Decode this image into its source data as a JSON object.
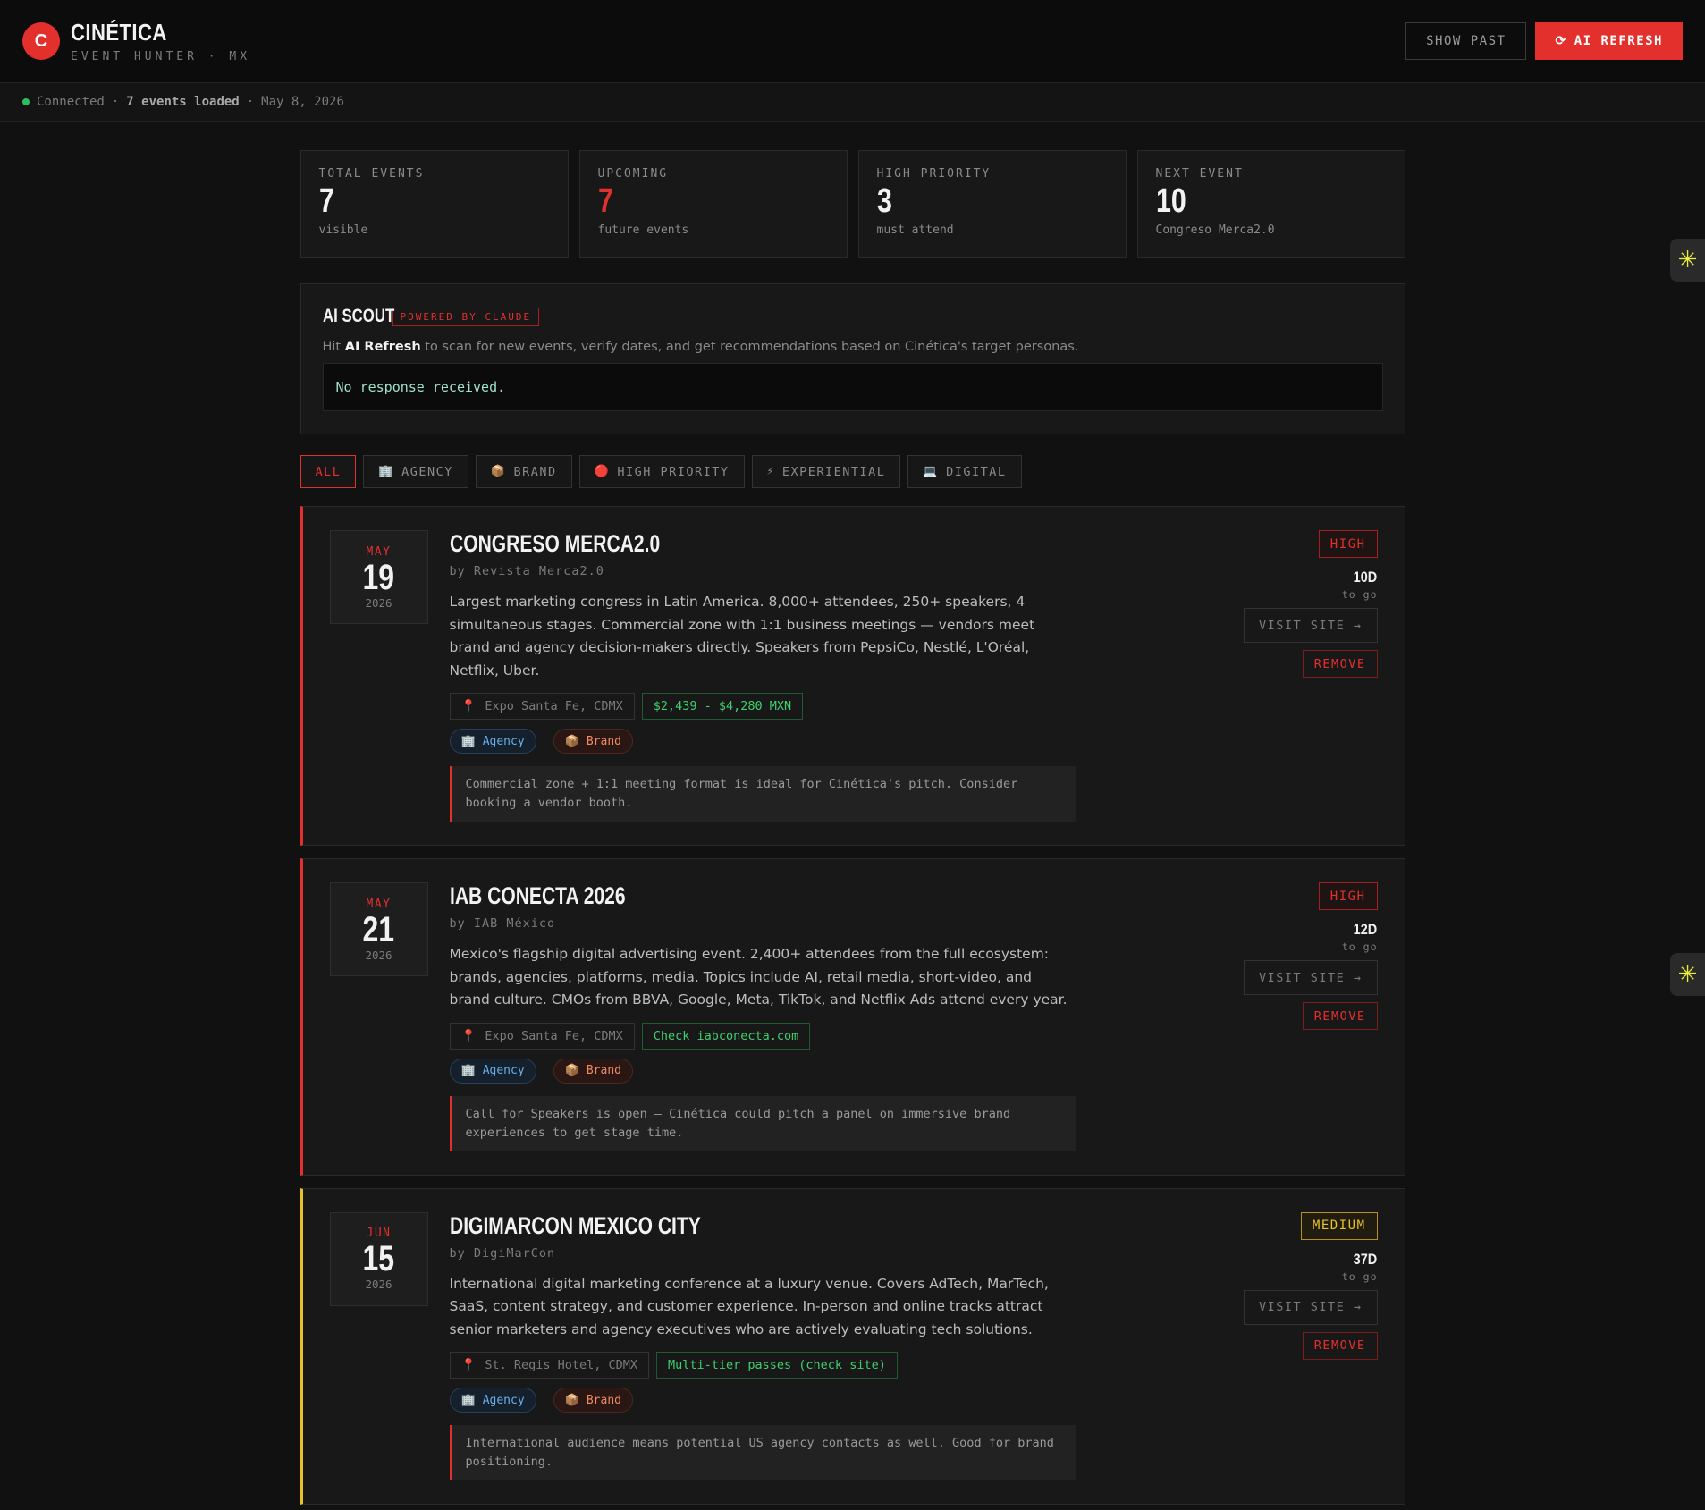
{
  "header": {
    "logo_letter": "C",
    "title": "CINÉTICA",
    "subtitle": "EVENT HUNTER · MX",
    "show_past_label": "SHOW PAST",
    "ai_refresh_label": "AI REFRESH",
    "refresh_icon": "⟳"
  },
  "status": {
    "connection": "Connected",
    "separator": "·",
    "loaded": "7 events loaded",
    "date": "May 8, 2026",
    "status_color": "#2ebf5a"
  },
  "stats": [
    {
      "label": "TOTAL EVENTS",
      "value": "7",
      "sub": "visible"
    },
    {
      "label": "UPCOMING",
      "value": "7",
      "sub": "future events"
    },
    {
      "label": "HIGH PRIORITY",
      "value": "3",
      "sub": "must attend"
    },
    {
      "label": "NEXT EVENT",
      "value": "10",
      "sub": "Congreso Merca2.0"
    }
  ],
  "scout": {
    "title": "AI SCOUT",
    "badge": "POWERED BY CLAUDE",
    "desc_prefix": "Hit",
    "desc_bold": "AI Refresh",
    "desc_suffix": "to scan for new events, verify dates, and get recommendations based on Cinética's target personas.",
    "response": "No response received."
  },
  "filters": [
    {
      "label": "ALL",
      "icon": ""
    },
    {
      "label": "AGENCY",
      "icon": "🏢"
    },
    {
      "label": "BRAND",
      "icon": "📦"
    },
    {
      "label": "HIGH PRIORITY",
      "icon": "🔴"
    },
    {
      "label": "EXPERIENTIAL",
      "icon": "⚡"
    },
    {
      "label": "DIGITAL",
      "icon": "💻"
    }
  ],
  "events": [
    {
      "month": "MAY",
      "day": "19",
      "year": "2026",
      "title": "CONGRESO MERCA2.0",
      "by": "by Revista Merca2.0",
      "desc": "Largest marketing congress in Latin America. 8,000+ attendees, 250+ speakers, 4 simultaneous stages. Commercial zone with 1:1 business meetings — vendors meet brand and agency decision-makers directly. Speakers from PepsiCo, Nestlé, L'Oréal, Netflix, Uber.",
      "location": "Expo Santa Fe, CDMX",
      "price": "$2,439 - $4,280 MXN",
      "tag_agency": "Agency",
      "tag_brand": "Brand",
      "note": "Commercial zone + 1:1 meeting format is ideal for Cinética's pitch. Consider booking a vendor booth.",
      "priority": "HIGH",
      "days": "10D",
      "togo": "to go",
      "visit": "VISIT SITE →",
      "remove": "REMOVE"
    },
    {
      "month": "MAY",
      "day": "21",
      "year": "2026",
      "title": "IAB CONECTA 2026",
      "by": "by IAB México",
      "desc": "Mexico's flagship digital advertising event. 2,400+ attendees from the full ecosystem: brands, agencies, platforms, media. Topics include AI, retail media, short-video, and brand culture. CMOs from BBVA, Google, Meta, TikTok, and Netflix Ads attend every year.",
      "location": "Expo Santa Fe, CDMX",
      "price": "Check iabconecta.com",
      "tag_agency": "Agency",
      "tag_brand": "Brand",
      "note": "Call for Speakers is open — Cinética could pitch a panel on immersive brand experiences to get stage time.",
      "priority": "HIGH",
      "days": "12D",
      "togo": "to go",
      "visit": "VISIT SITE →",
      "remove": "REMOVE"
    },
    {
      "month": "JUN",
      "day": "15",
      "year": "2026",
      "title": "DIGIMARCON MEXICO CITY",
      "by": "by DigiMarCon",
      "desc": "International digital marketing conference at a luxury venue. Covers AdTech, MarTech, SaaS, content strategy, and customer experience. In-person and online tracks attract senior marketers and agency executives who are actively evaluating tech solutions.",
      "location": "St. Regis Hotel, CDMX",
      "price": "Multi-tier passes (check site)",
      "tag_agency": "Agency",
      "tag_brand": "Brand",
      "note": "International audience means potential US agency contacts as well. Good for brand positioning.",
      "priority": "MEDIUM",
      "days": "37D",
      "togo": "to go",
      "visit": "VISIT SITE →",
      "remove": "REMOVE"
    }
  ],
  "icons": {
    "pin": "📍",
    "agency": "🏢",
    "brand": "📦",
    "widget": "✳"
  },
  "colors": {
    "accent": "#e3302c",
    "medium": "#e8c12a",
    "price_green": "#3ecf6e"
  }
}
